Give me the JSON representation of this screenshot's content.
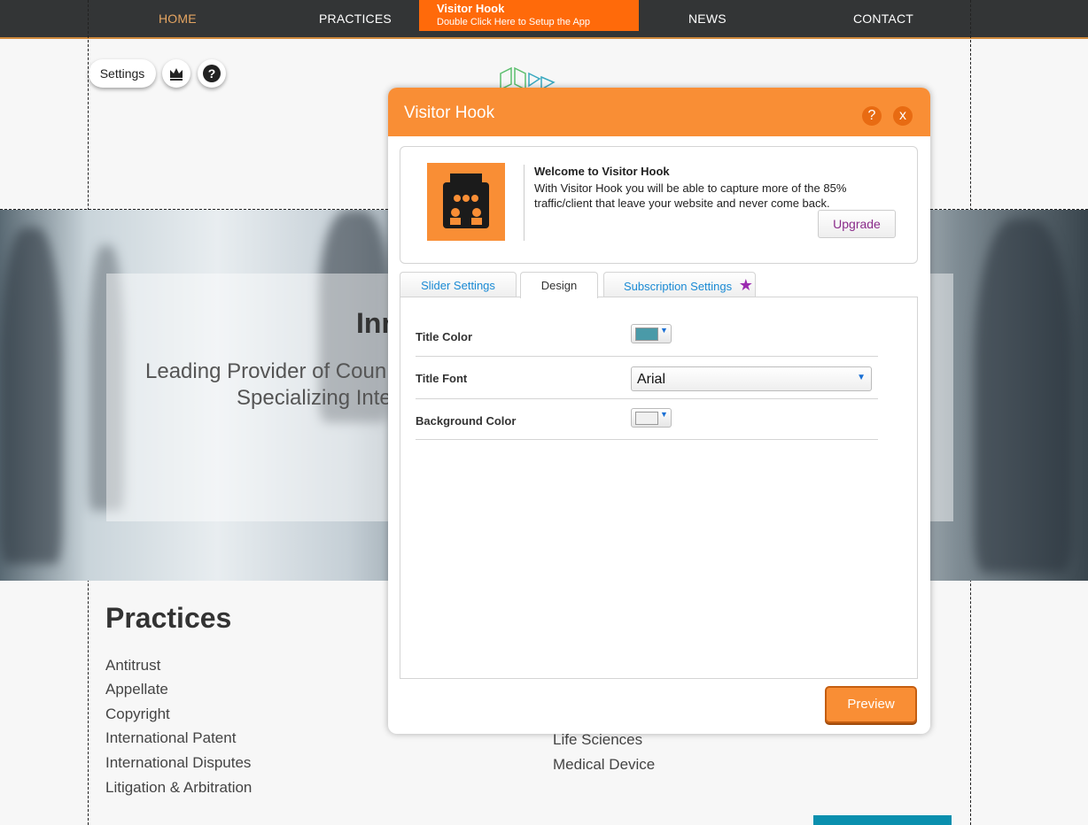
{
  "nav": {
    "items": [
      "HOME",
      "PRACTICES",
      "NEWS",
      "CONTACT"
    ],
    "app_title": "Visitor Hook",
    "app_subtitle": "Double Click Here to Setup the App"
  },
  "editor": {
    "settings_label": "Settings",
    "crown_icon": "crown-icon",
    "help_icon": "question-icon"
  },
  "hero": {
    "title_partial": "Inn",
    "subtitle_line1": "Leading Provider of Coun",
    "subtitle_line2": "Specializing Inte"
  },
  "practices": {
    "title": "Practices",
    "col1": [
      "Antitrust",
      "Appellate",
      "Copyright",
      "International Patent",
      "International Disputes",
      "Litigation & Arbitration"
    ],
    "col2": [
      "Life Sciences",
      "Medical Device"
    ]
  },
  "modal": {
    "title": "Visitor Hook",
    "help_label": "?",
    "close_label": "x",
    "welcome_title": "Welcome to Visitor Hook",
    "welcome_text": "With Visitor Hook you will be able to capture more of the 85% traffic/client that leave your website and never come back.",
    "upgrade_label": "Upgrade",
    "tabs": [
      "Slider Settings",
      "Design",
      "Subscription Settings"
    ],
    "active_tab": "Design",
    "design": {
      "title_color_label": "Title Color",
      "title_color_value": "#4a9aa8",
      "title_font_label": "Title Font",
      "title_font_value": "Arial",
      "background_color_label": "Background Color",
      "background_color_value": "#f0f0f0"
    },
    "preview_label": "Preview"
  },
  "colors": {
    "accent": "#f98e35",
    "nav_bg": "#333536",
    "nav_active": "#e5a562",
    "app_tab": "#ff6a0a",
    "link_blue": "#1a8ad4",
    "upgrade_purple": "#8a2b8a"
  }
}
